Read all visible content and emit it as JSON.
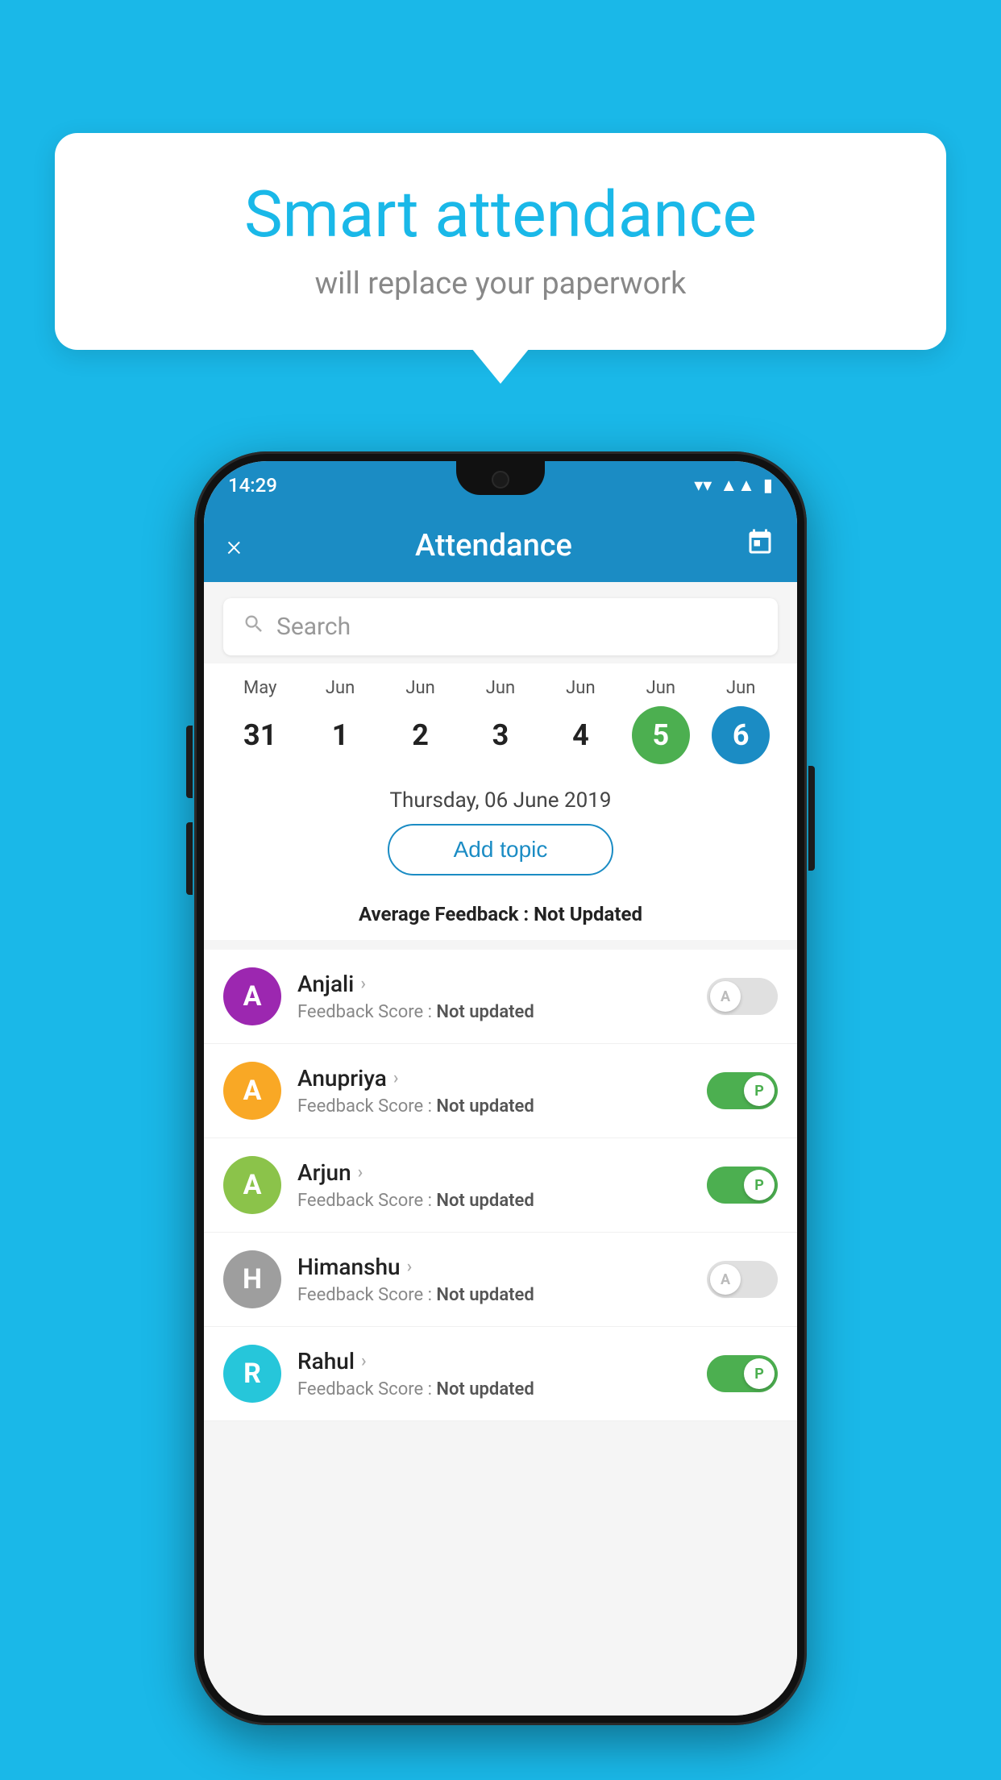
{
  "background_color": "#1ab8e8",
  "bubble": {
    "title": "Smart attendance",
    "subtitle": "will replace your paperwork"
  },
  "status_bar": {
    "time": "14:29",
    "icons": [
      "wifi",
      "signal",
      "battery"
    ]
  },
  "header": {
    "title": "Attendance",
    "close_label": "×",
    "calendar_icon": "📅"
  },
  "search": {
    "placeholder": "Search"
  },
  "calendar": {
    "days": [
      {
        "month": "May",
        "date": "31",
        "state": "normal"
      },
      {
        "month": "Jun",
        "date": "1",
        "state": "normal"
      },
      {
        "month": "Jun",
        "date": "2",
        "state": "normal"
      },
      {
        "month": "Jun",
        "date": "3",
        "state": "normal"
      },
      {
        "month": "Jun",
        "date": "4",
        "state": "normal"
      },
      {
        "month": "Jun",
        "date": "5",
        "state": "today"
      },
      {
        "month": "Jun",
        "date": "6",
        "state": "selected"
      }
    ]
  },
  "selected_date_label": "Thursday, 06 June 2019",
  "add_topic_label": "Add topic",
  "avg_feedback_prefix": "Average Feedback : ",
  "avg_feedback_value": "Not Updated",
  "students": [
    {
      "name": "Anjali",
      "avatar_letter": "A",
      "avatar_color": "#9c27b0",
      "feedback_prefix": "Feedback Score : ",
      "feedback_value": "Not updated",
      "attendance": "absent"
    },
    {
      "name": "Anupriya",
      "avatar_letter": "A",
      "avatar_color": "#f9a825",
      "feedback_prefix": "Feedback Score : ",
      "feedback_value": "Not updated",
      "attendance": "present"
    },
    {
      "name": "Arjun",
      "avatar_letter": "A",
      "avatar_color": "#8bc34a",
      "feedback_prefix": "Feedback Score : ",
      "feedback_value": "Not updated",
      "attendance": "present"
    },
    {
      "name": "Himanshu",
      "avatar_letter": "H",
      "avatar_color": "#9e9e9e",
      "feedback_prefix": "Feedback Score : ",
      "feedback_value": "Not updated",
      "attendance": "absent"
    },
    {
      "name": "Rahul",
      "avatar_letter": "R",
      "avatar_color": "#26c6da",
      "feedback_prefix": "Feedback Score : ",
      "feedback_value": "Not updated",
      "attendance": "present"
    }
  ]
}
